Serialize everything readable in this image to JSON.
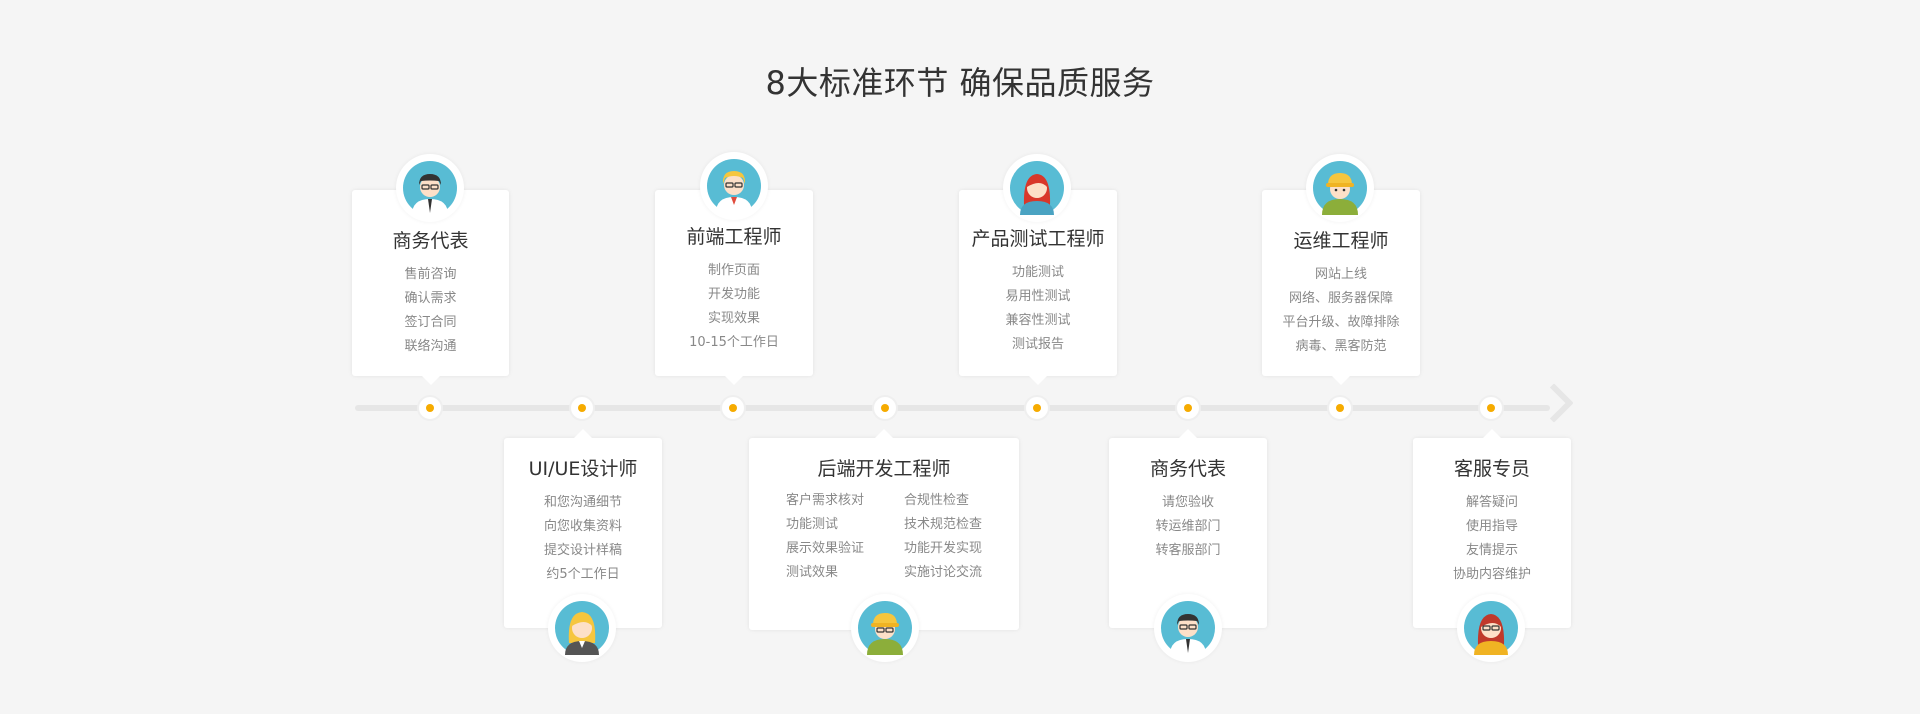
{
  "title": "8大标准环节 确保品质服务",
  "colors": {
    "accent": "#f6ab00",
    "avatar_bg": "#58bcd4",
    "line": "#e6e6e6"
  },
  "top_cards": [
    {
      "title": "商务代表",
      "items": [
        "售前咨询",
        "确认需求",
        "签订合同",
        "联络沟通"
      ],
      "avatar": "businessman-avatar-icon"
    },
    {
      "title": "前端工程师",
      "items": [
        "制作页面",
        "开发功能",
        "实现效果",
        "10-15个工作日"
      ],
      "avatar": "blonde-engineer-avatar-icon"
    },
    {
      "title": "产品测试工程师",
      "items": [
        "功能测试",
        "易用性测试",
        "兼容性测试",
        "测试报告"
      ],
      "avatar": "red-hair-woman-avatar-icon"
    },
    {
      "title": "运维工程师",
      "items": [
        "网站上线",
        "网络、服务器保障",
        "平台升级、故障排除",
        "病毒、黑客防范"
      ],
      "avatar": "hardhat-worker-avatar-icon"
    }
  ],
  "bottom_cards": [
    {
      "title": "UI/UE设计师",
      "items": [
        "和您沟通细节",
        "向您收集资料",
        "提交设计样稿",
        "约5个工作日"
      ],
      "avatar": "blonde-woman-avatar-icon"
    },
    {
      "title": "后端开发工程师",
      "col1": [
        "客户需求核对",
        "功能测试",
        "展示效果验证",
        "测试效果"
      ],
      "col2": [
        "合规性检查",
        "技术规范检查",
        "功能开发实现",
        "实施讨论交流"
      ],
      "avatar": "hardhat-engineer-avatar-icon"
    },
    {
      "title": "商务代表",
      "items": [
        "请您验收",
        "转运维部门",
        "转客服部门"
      ],
      "avatar": "businessman-avatar-icon"
    },
    {
      "title": "客服专员",
      "items": [
        "解答疑问",
        "使用指导",
        "友情提示",
        "协助内容维护"
      ],
      "avatar": "service-woman-avatar-icon"
    }
  ]
}
